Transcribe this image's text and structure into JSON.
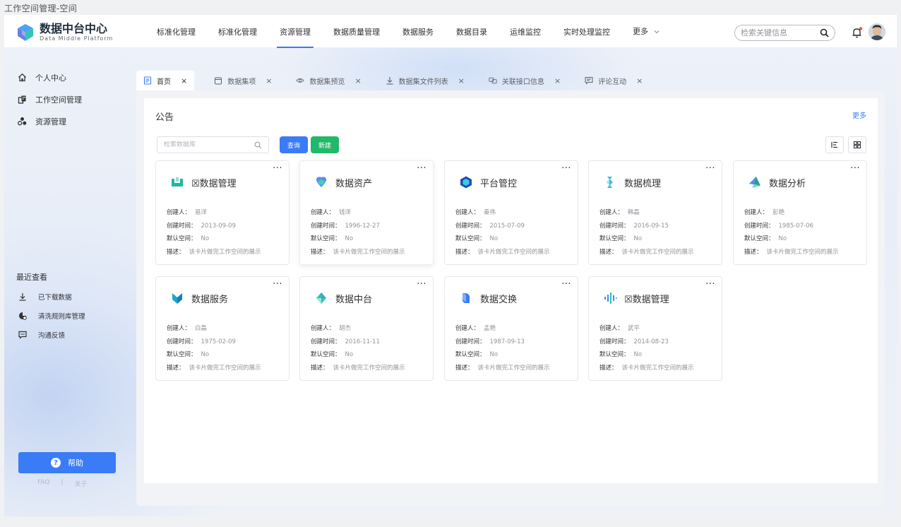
{
  "window_title": "工作空间管理-空间",
  "logo": {
    "title": "数据中台中心",
    "subtitle": "Data Middle Platform"
  },
  "nav": {
    "items": [
      "标准化管理",
      "标准化管理",
      "资源管理",
      "数据质量管理",
      "数据服务",
      "数据目录",
      "运维监控",
      "实时处理监控"
    ],
    "more_label": "更多",
    "active_index": 2
  },
  "top_search": {
    "placeholder": "检索关键信息",
    "value": ""
  },
  "sidebar": {
    "items": [
      {
        "label": "个人中心",
        "icon": "home-icon"
      },
      {
        "label": "工作空间管理",
        "icon": "workspace-icon"
      },
      {
        "label": "资源管理",
        "icon": "resource-icon"
      }
    ],
    "recent_title": "最近查看",
    "recent": [
      {
        "label": "已下载数据",
        "icon": "download-icon"
      },
      {
        "label": "清洗规则库管理",
        "icon": "rules-icon"
      },
      {
        "label": "沟通反馈",
        "icon": "feedback-icon"
      }
    ],
    "help_label": "帮助",
    "faq_label": "FAQ",
    "sep": "|",
    "about_label": "关于"
  },
  "tabs": [
    {
      "label": "首页",
      "icon": "document-icon",
      "active": true
    },
    {
      "label": "数据集项",
      "icon": "box-icon",
      "active": false
    },
    {
      "label": "数据集预览",
      "icon": "eye-icon",
      "active": false
    },
    {
      "label": "数据集文件列表",
      "icon": "download-icon",
      "active": false
    },
    {
      "label": "关联接口信息",
      "icon": "link-icon",
      "active": false
    },
    {
      "label": "评论互动",
      "icon": "comment-icon",
      "active": false
    }
  ],
  "tab_close": "×",
  "panel": {
    "title": "公告",
    "more": "更多",
    "search_placeholder": "检索数据库",
    "query_label": "查询",
    "new_label": "新建"
  },
  "card_labels": {
    "creator": "创建人：",
    "created": "创建时间：",
    "default_space": "默认空间：",
    "desc": "描述："
  },
  "card_menu": "···",
  "cards": [
    {
      "name": "☒数据管理",
      "icon": "data-management-icon",
      "color": "#22b8a0",
      "creator": "易洋",
      "created": "2013-09-09",
      "default_space": "No",
      "desc": "该卡片做完工作空间的展示"
    },
    {
      "name": "数据资产",
      "icon": "data-asset-icon",
      "color": "#5b8cf0",
      "creator": "钱洋",
      "created": "1996-12-27",
      "default_space": "No",
      "desc": "该卡片做完工作空间的展示"
    },
    {
      "name": "平台管控",
      "icon": "platform-control-icon",
      "color": "#1e4fb6",
      "creator": "秦伟",
      "created": "2015-07-09",
      "default_space": "No",
      "desc": "该卡片做完工作空间的展示"
    },
    {
      "name": "数据梳理",
      "icon": "data-sorting-icon",
      "color": "#49b8d8",
      "creator": "韩磊",
      "created": "2016-09-15",
      "default_space": "No",
      "desc": "该卡片做完工作空间的展示"
    },
    {
      "name": "数据分析",
      "icon": "data-analysis-icon",
      "color": "#2a9d8f",
      "creator": "彭艳",
      "created": "1985-07-06",
      "default_space": "No",
      "desc": "该卡片做完工作空间的展示"
    },
    {
      "name": "数据服务",
      "icon": "data-service-icon",
      "color": "#1ea6c8",
      "creator": "白磊",
      "created": "1975-02-09",
      "default_space": "No",
      "desc": "该卡片做完工作空间的展示"
    },
    {
      "name": "数据中台",
      "icon": "data-platform-icon",
      "color": "#2fc4b0",
      "creator": "胡杰",
      "created": "2016-11-11",
      "default_space": "No",
      "desc": "该卡片做完工作空间的展示"
    },
    {
      "name": "数据交换",
      "icon": "data-exchange-icon",
      "color": "#3a7bf6",
      "creator": "孟艳",
      "created": "1987-09-13",
      "default_space": "No",
      "desc": "该卡片做完工作空间的展示"
    },
    {
      "name": "☒数据管理",
      "icon": "data-wave-icon",
      "color": "#3a8ef6",
      "creator": "武平",
      "created": "2014-08-23",
      "default_space": "No",
      "desc": "该卡片做完工作空间的展示"
    }
  ],
  "raised_card_index": 1,
  "colors": {
    "accent": "#3a7bf6",
    "success": "#22b86a",
    "notification_dot": "#f04a4a"
  }
}
